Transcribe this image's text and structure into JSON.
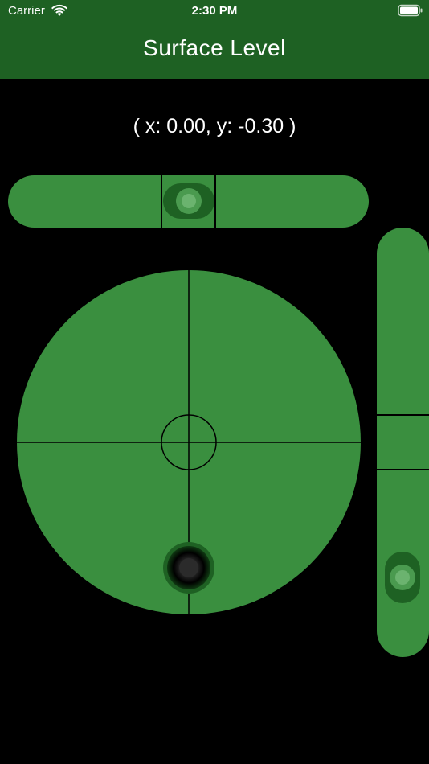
{
  "status_bar": {
    "carrier": "Carrier",
    "time": "2:30 PM",
    "wifi_icon": "wifi-icon",
    "battery_icon": "battery-icon"
  },
  "header": {
    "title": "Surface Level"
  },
  "readout": {
    "text": "( x: 0.00, y: -0.30 )",
    "x": 0.0,
    "y": -0.3
  },
  "colors": {
    "header": "#1e6123",
    "background": "#000000",
    "vial": "#3a8f3f",
    "bubble_ring": "#1e6123",
    "bubble_inner": "#4a9a4f",
    "bubble_core": "#6bb36f",
    "surface_bubble_core": "#2b2b2b"
  }
}
